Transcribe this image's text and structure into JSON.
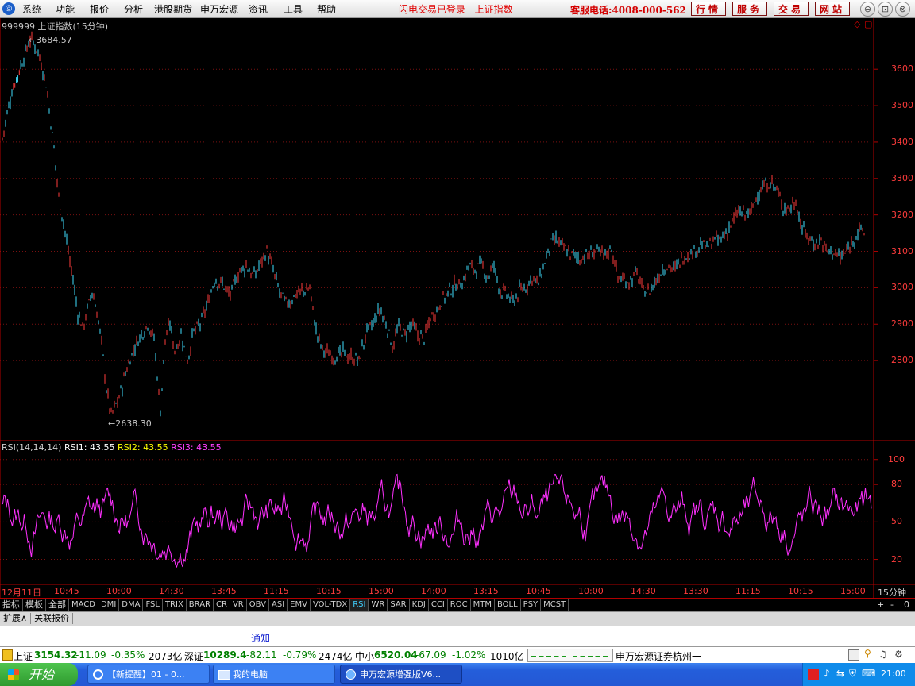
{
  "menu": [
    "系统",
    "功能",
    "报价",
    "分析",
    "港股期货",
    "申万宏源",
    "资讯",
    "工具",
    "帮助"
  ],
  "status_msg": [
    "闪电交易已登录",
    "上证指数"
  ],
  "hotline": "客服电话:4008-000-562",
  "top_buttons": [
    "行情",
    "服务",
    "交易",
    "网站"
  ],
  "window_controls": [
    "⊖",
    "⊡",
    "⊗"
  ],
  "chart_title": "999999 上证指数(15分钟)",
  "chart_data": {
    "type": "candlestick",
    "title": "999999 上证指数(15分钟)",
    "y_ticks": [
      3600,
      3500,
      3400,
      3300,
      3200,
      3100,
      3000,
      2900,
      2800
    ],
    "ylim": [
      2580,
      3740
    ],
    "high_label": "3684.57",
    "low_label": "2638.30",
    "x_tick_labels": [
      "12月11日",
      "10:45",
      "10:00",
      "14:30",
      "13:45",
      "11:15",
      "10:15",
      "15:00",
      "14:00",
      "13:15",
      "10:45",
      "10:00",
      "14:30",
      "13:30",
      "11:15",
      "10:15",
      "15:00"
    ],
    "path_x": [
      3,
      15,
      28,
      38,
      48,
      58,
      68,
      74,
      80,
      86,
      92,
      98,
      104,
      110,
      116,
      122,
      128,
      134,
      140,
      150,
      160,
      170,
      178,
      186,
      194,
      202,
      208,
      214,
      220,
      228,
      236,
      244,
      252,
      262,
      270,
      280,
      290,
      300,
      310,
      320,
      330,
      336,
      342,
      350,
      358,
      366,
      374,
      382,
      390,
      398,
      406,
      414,
      422,
      432,
      442,
      452,
      462,
      470,
      478,
      486,
      494,
      502,
      510,
      518,
      526,
      534,
      542,
      550,
      558,
      566,
      574,
      582,
      590,
      598,
      606,
      614,
      622,
      630,
      638,
      646,
      654,
      662,
      670,
      678,
      686,
      694,
      700,
      710,
      720,
      730,
      740,
      750,
      760,
      770,
      778,
      786,
      794,
      802,
      810,
      818,
      826,
      834,
      842,
      850,
      858,
      866,
      874,
      882,
      890,
      898,
      906,
      914,
      922,
      930,
      938,
      946,
      954,
      962,
      970,
      978,
      986,
      994,
      1002,
      1010,
      1018,
      1026,
      1034,
      1042,
      1050,
      1058,
      1066,
      1074,
      1082,
      1090,
      1098
    ],
    "path_y": [
      3410,
      3540,
      3620,
      3684,
      3650,
      3560,
      3380,
      3250,
      3180,
      3100,
      3020,
      2930,
      2890,
      2940,
      2990,
      2930,
      2850,
      2720,
      2650,
      2700,
      2780,
      2840,
      2870,
      2900,
      2860,
      2660,
      2860,
      2900,
      2830,
      2870,
      2800,
      2880,
      2900,
      2960,
      3020,
      3010,
      2980,
      3040,
      3060,
      3030,
      3080,
      3100,
      3060,
      3000,
      2960,
      2960,
      2990,
      2990,
      3000,
      2880,
      2830,
      2820,
      2810,
      2820,
      2810,
      2800,
      2880,
      2900,
      2940,
      2900,
      2840,
      2890,
      2870,
      2900,
      2870,
      2860,
      2920,
      2940,
      2970,
      2990,
      3010,
      3010,
      3060,
      3050,
      3060,
      3030,
      3060,
      2990,
      2980,
      2960,
      2990,
      3000,
      3030,
      3010,
      3070,
      3120,
      3130,
      3110,
      3090,
      3080,
      3090,
      3100,
      3090,
      3110,
      3030,
      3020,
      3020,
      3040,
      2990,
      2990,
      3020,
      3050,
      3060,
      3050,
      3080,
      3090,
      3100,
      3120,
      3110,
      3130,
      3130,
      3150,
      3180,
      3210,
      3200,
      3210,
      3260,
      3280,
      3290,
      3270,
      3220,
      3220,
      3240,
      3160,
      3140,
      3120,
      3130,
      3100,
      3100,
      3080,
      3100,
      3130,
      3160,
      3150
    ],
    "rsi_label": "RSI(14,14,14)",
    "rsi1": "RSI1: 43.55",
    "rsi2": "RSI2: 43.55",
    "rsi3": "RSI3: 43.55",
    "rsi_ticks": [
      100,
      80,
      50,
      20
    ],
    "rsi_ylim": [
      0,
      110
    ],
    "period_label": "15分钟"
  },
  "indicator_tabs": [
    "指标",
    "模板",
    "全部",
    "MACD",
    "DMI",
    "DMA",
    "FSL",
    "TRIX",
    "BRAR",
    "CR",
    "VR",
    "OBV",
    "ASI",
    "EMV",
    "VOL-TDX",
    "RSI",
    "WR",
    "SAR",
    "KDJ",
    "CCI",
    "ROC",
    "MTM",
    "BOLL",
    "PSY",
    "MCST"
  ],
  "tab_controls": [
    "+",
    "-",
    "0"
  ],
  "sub_tabs": [
    "扩展∧",
    "关联报价"
  ],
  "notice": "通知",
  "ticker": {
    "sh_name": "上证",
    "sh_val": "3154.32",
    "sh_chg": "-11.09",
    "sh_pct": "-0.35%",
    "sh_amt": "2073亿",
    "sz_name": "深证",
    "sz_val": "10289.4",
    "sz_chg": "-82.11",
    "sz_pct": "-0.79%",
    "sz_amt": "2474亿",
    "zx_name": "中小",
    "zx_val": "6520.04",
    "zx_chg": "-67.09",
    "zx_pct": "-1.02%",
    "zx_amt": "1010亿",
    "broker": "申万宏源证券杭州一"
  },
  "taskbar": {
    "start": "开始",
    "tasks": [
      "【新提醒】01 - 0...",
      "我的电脑",
      "申万宏源增强版V6..."
    ],
    "clock": "21:00"
  }
}
